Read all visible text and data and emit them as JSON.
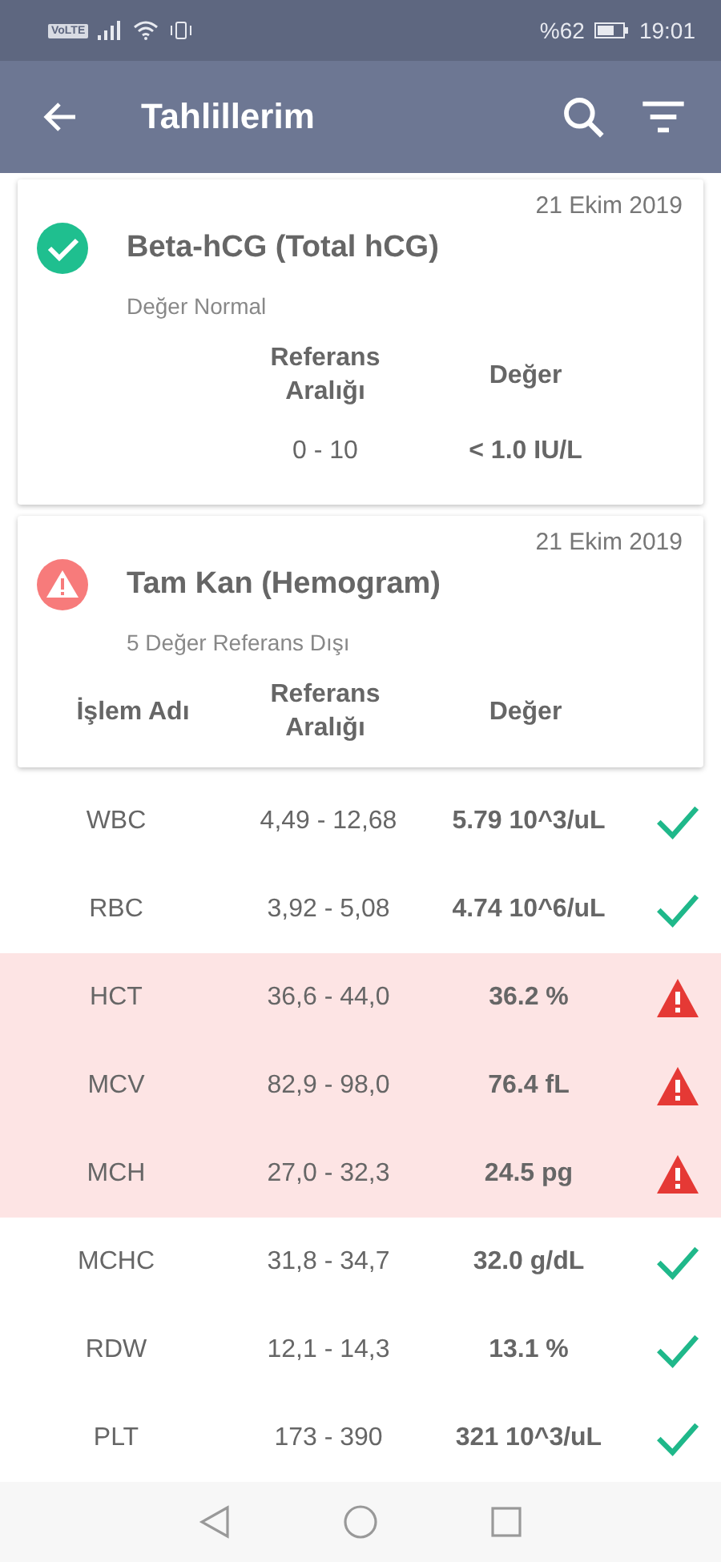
{
  "status_bar": {
    "network_badge": "VoLTE",
    "battery_text": "%62",
    "time": "19:01"
  },
  "app_bar": {
    "title": "Tahlillerim"
  },
  "cards": [
    {
      "date": "21 Ekim 2019",
      "title": "Beta-hCG (Total hCG)",
      "kind": "normal",
      "summary": "Değer Normal",
      "columns": [
        "",
        "Referans Aralığı",
        "Değer"
      ],
      "rows": [
        {
          "name": "",
          "range": "0 - 10",
          "value": "< 1.0 IU/L"
        }
      ]
    },
    {
      "date": "21 Ekim 2019",
      "title": "Tam Kan (Hemogram)",
      "kind": "abnormal",
      "summary": "5 Değer Referans Dışı",
      "columns": [
        "İşlem Adı",
        "Referans Aralığı",
        "Değer"
      ]
    }
  ],
  "results": [
    {
      "name": "WBC",
      "range": "4,49 - 12,68",
      "value": "5.79 10^3/uL",
      "out_of_range": false
    },
    {
      "name": "RBC",
      "range": "3,92 - 5,08",
      "value": "4.74 10^6/uL",
      "out_of_range": false
    },
    {
      "name": "HCT",
      "range": "36,6 - 44,0",
      "value": "36.2 %",
      "out_of_range": true
    },
    {
      "name": "MCV",
      "range": "82,9 - 98,0",
      "value": "76.4 fL",
      "out_of_range": true
    },
    {
      "name": "MCH",
      "range": "27,0 - 32,3",
      "value": "24.5 pg",
      "out_of_range": true
    },
    {
      "name": "MCHC",
      "range": "31,8 - 34,7",
      "value": "32.0 g/dL",
      "out_of_range": false
    },
    {
      "name": "RDW",
      "range": "12,1 - 14,3",
      "value": "13.1 %",
      "out_of_range": false
    },
    {
      "name": "PLT",
      "range": "173 - 390",
      "value": "321 10^3/uL",
      "out_of_range": false
    }
  ]
}
